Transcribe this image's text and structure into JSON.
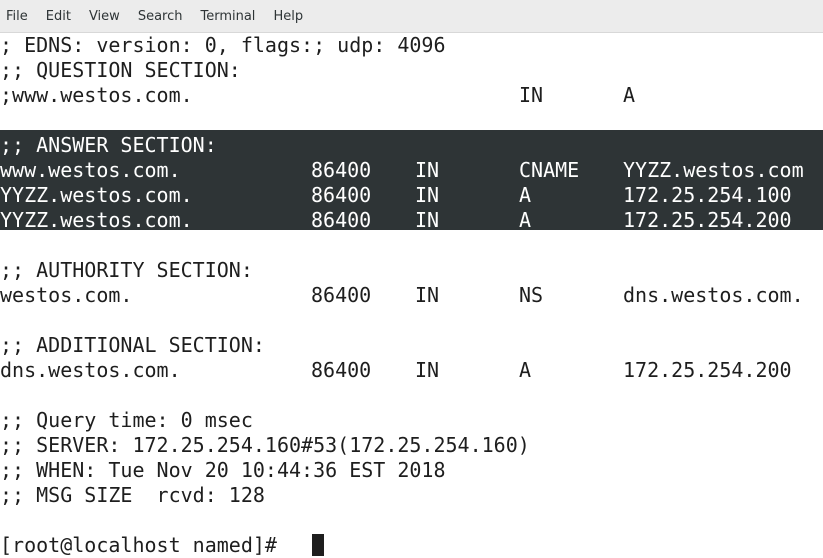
{
  "menu": [
    "File",
    "Edit",
    "View",
    "Search",
    "Terminal",
    "Help"
  ],
  "lines": {
    "edns": "; EDNS: version: 0, flags:; udp: 4096",
    "question_header": ";; QUESTION SECTION:",
    "question": {
      "name": ";www.westos.com.",
      "class": "IN",
      "type": "A"
    },
    "answer_header": ";; ANSWER SECTION:",
    "answer": [
      {
        "name": "www.westos.com.",
        "ttl": "86400",
        "class": "IN",
        "type": "CNAME",
        "data": "YYZZ.westos.com"
      },
      {
        "name": "YYZZ.westos.com.",
        "ttl": "86400",
        "class": "IN",
        "type": "A",
        "data": "172.25.254.100"
      },
      {
        "name": "YYZZ.westos.com.",
        "ttl": "86400",
        "class": "IN",
        "type": "A",
        "data": "172.25.254.200"
      }
    ],
    "authority_header": ";; AUTHORITY SECTION:",
    "authority": {
      "name": "westos.com.",
      "ttl": "86400",
      "class": "IN",
      "type": "NS",
      "data": "dns.westos.com."
    },
    "additional_header": ";; ADDITIONAL SECTION:",
    "additional": {
      "name": "dns.westos.com.",
      "ttl": "86400",
      "class": "IN",
      "type": "A",
      "data": "172.25.254.200"
    },
    "query_time": ";; Query time: 0 msec",
    "server": ";; SERVER: 172.25.254.160#53(172.25.254.160)",
    "when": ";; WHEN: Tue Nov 20 10:44:36 EST 2018",
    "msg_size": ";; MSG SIZE  rcvd: 128",
    "prompt": "[root@localhost named]# "
  },
  "colors": {
    "menubar_bg": "#ececec",
    "terminal_bg": "#ffffff",
    "terminal_fg": "#1e1e1e",
    "selection_bg": "#2e3436",
    "selection_fg": "#ffffff"
  }
}
